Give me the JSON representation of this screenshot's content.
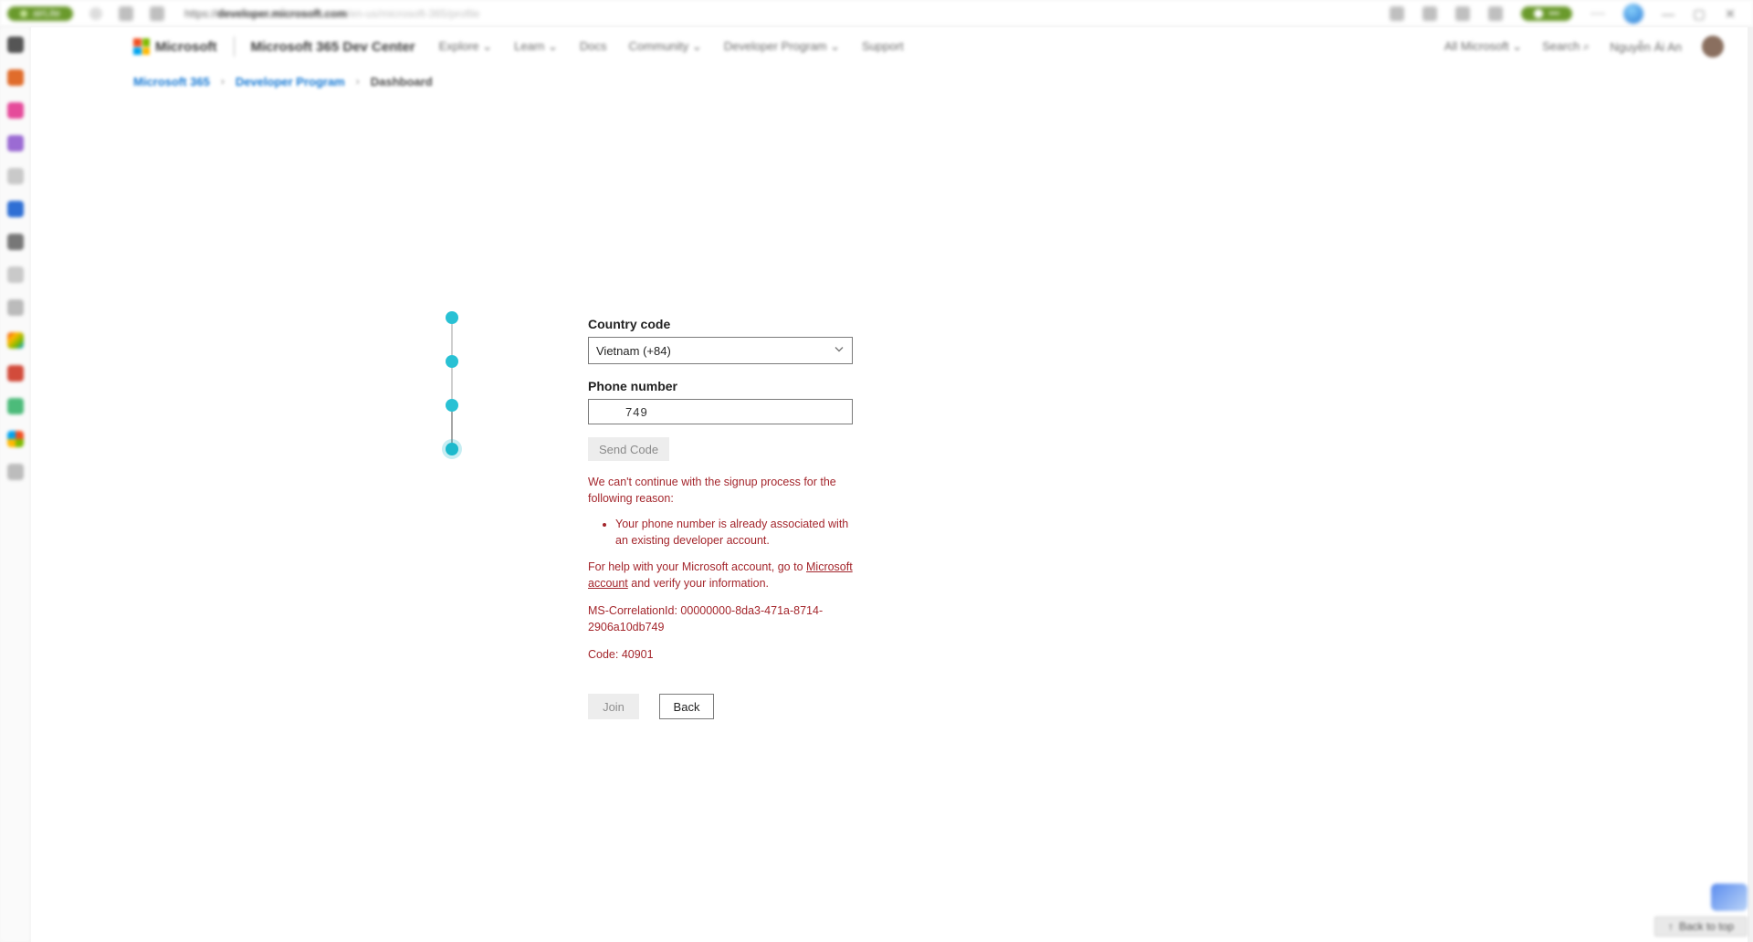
{
  "browser": {
    "left_pill": "airLite",
    "url_dark": "developer.microsoft.com",
    "url_rest": "/en-us/microsoft-365/profile",
    "right_pill": "•••",
    "win_min": "—",
    "win_max": "▢",
    "win_close": "✕"
  },
  "header": {
    "brand": "Microsoft",
    "site_title": "Microsoft 365 Dev Center",
    "nav": [
      "Explore ⌄",
      "Learn ⌄",
      "Docs",
      "Community ⌄",
      "Developer Program ⌄",
      "Support"
    ],
    "right": [
      "All Microsoft ⌄",
      "Search ⌕",
      "Nguyễn Ái An"
    ]
  },
  "breadcrumb": {
    "items": [
      "Microsoft 365",
      "Developer Program",
      "Dashboard"
    ],
    "sep": "›"
  },
  "form": {
    "country_label": "Country code",
    "country_value": "Vietnam (+84)",
    "phone_label": "Phone number",
    "phone_value": "749",
    "send_code": "Send Code"
  },
  "error": {
    "intro": "We can't continue with the signup process for the following reason:",
    "bullet": "Your phone number is already associated with an existing developer account.",
    "help_pre": "For help with your Microsoft account, go to ",
    "help_link": "Microsoft account",
    "help_post": " and verify your information.",
    "correlation": "MS-CorrelationId: 00000000-8da3-471a-8714-2906a10db749",
    "code": "Code: 40901"
  },
  "actions": {
    "join": "Join",
    "back": "Back"
  },
  "footer": {
    "back_to_top": "↑ Back to top"
  }
}
